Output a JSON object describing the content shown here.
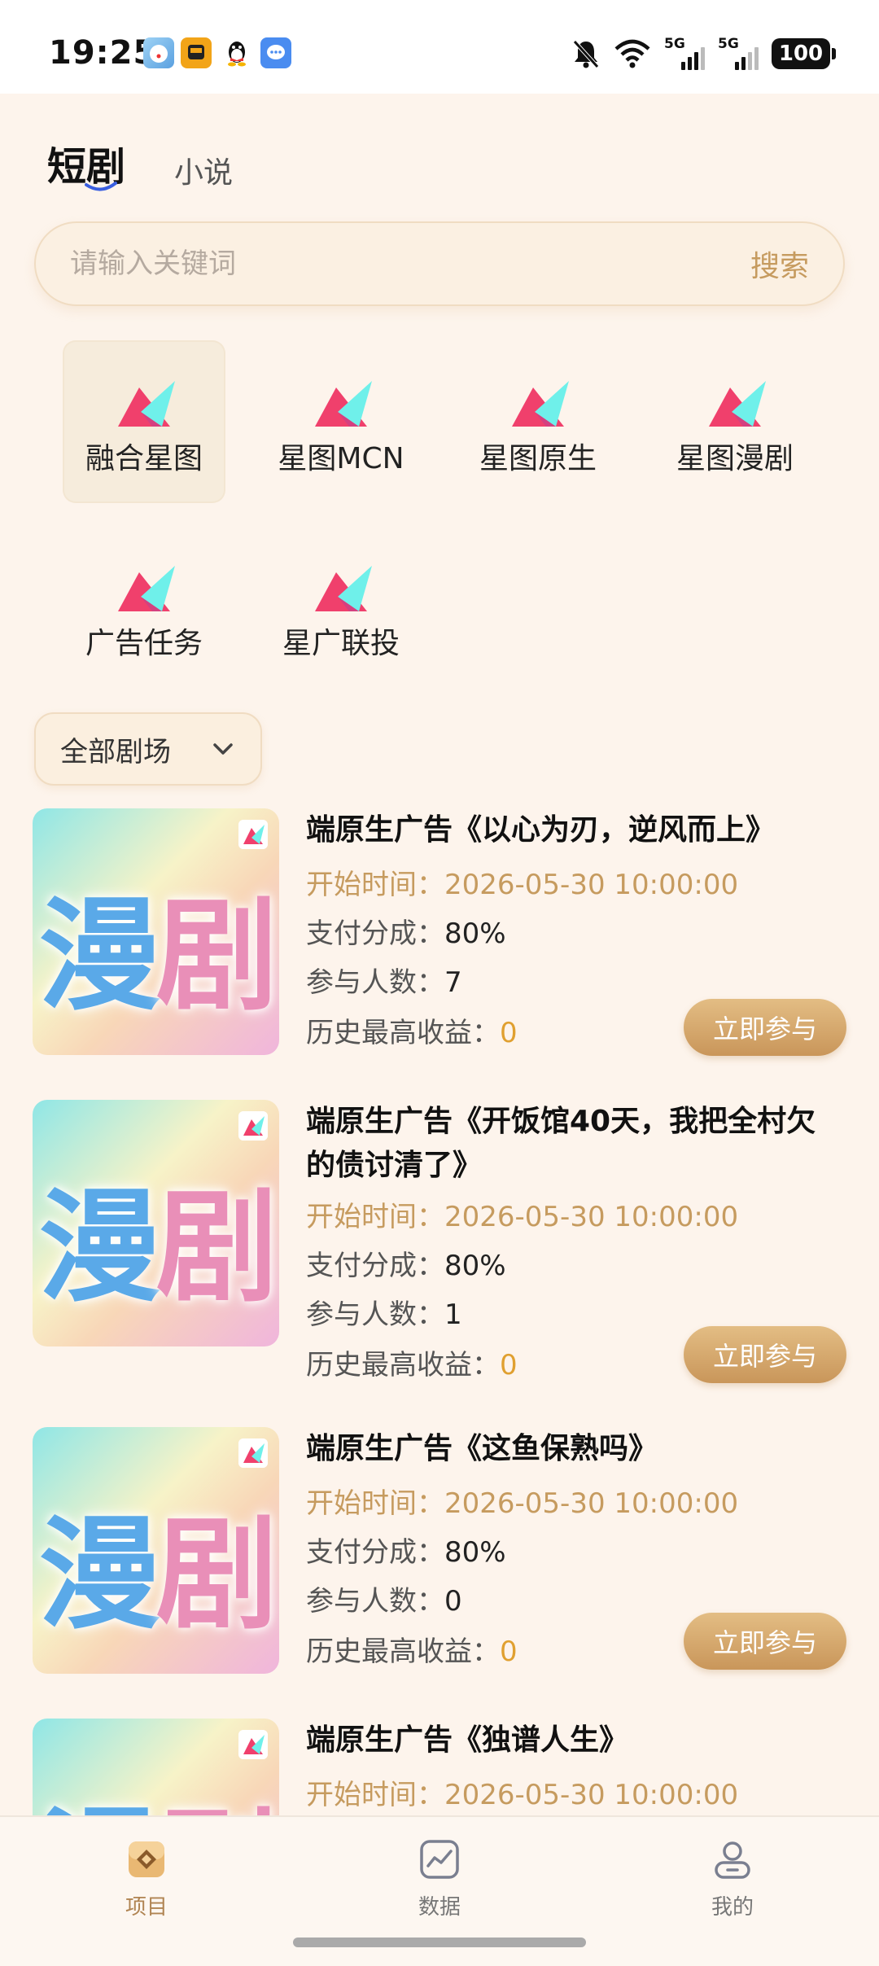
{
  "status_bar": {
    "time": "19:25",
    "battery": "100",
    "signal_labels": [
      "5G",
      "5G"
    ],
    "notification_app_icons": [
      "doraemon-app-icon",
      "train-ticket-app-icon",
      "qq-penguin-icon",
      "message-bubble-icon"
    ]
  },
  "top_tabs": [
    {
      "label": "短剧",
      "active": true
    },
    {
      "label": "小说",
      "active": false
    }
  ],
  "search": {
    "placeholder": "请输入关键词",
    "button_label": "搜索"
  },
  "categories": [
    {
      "label": "融合星图",
      "selected": true
    },
    {
      "label": "星图MCN",
      "selected": false
    },
    {
      "label": "星图原生",
      "selected": false
    },
    {
      "label": "星图漫剧",
      "selected": false
    },
    {
      "label": "广告任务",
      "selected": false
    },
    {
      "label": "星广联投",
      "selected": false
    }
  ],
  "filter": {
    "label": "全部剧场"
  },
  "field_labels": {
    "start_time": "开始时间：",
    "revenue_share": "支付分成：",
    "participants": "参与人数：",
    "max_earnings": "历史最高收益："
  },
  "items": [
    {
      "thumb_text": "漫剧",
      "title": "端原生广告《以心为刃，逆风而上》",
      "start_time": "2026-05-30 10:00:00",
      "revenue_share": "80%",
      "participants": "7",
      "max_earnings": "0",
      "join_label": "立即参与"
    },
    {
      "thumb_text": "漫剧",
      "title": "端原生广告《开饭馆40天，我把全村欠的债讨清了》",
      "start_time": "2026-05-30 10:00:00",
      "revenue_share": "80%",
      "participants": "1",
      "max_earnings": "0",
      "join_label": "立即参与"
    },
    {
      "thumb_text": "漫剧",
      "title": "端原生广告《这鱼保熟吗》",
      "start_time": "2026-05-30 10:00:00",
      "revenue_share": "80%",
      "participants": "0",
      "max_earnings": "0",
      "join_label": "立即参与"
    },
    {
      "thumb_text": "漫剧",
      "title": "端原生广告《独谱人生》",
      "start_time": "2026-05-30 10:00:00"
    }
  ],
  "bottom_nav": [
    {
      "label": "项目",
      "icon": "project-icon",
      "active": true
    },
    {
      "label": "数据",
      "icon": "chart-icon",
      "active": false
    },
    {
      "label": "我的",
      "icon": "profile-icon",
      "active": false
    }
  ],
  "colors": {
    "accent_gold": "#c69b5f",
    "button_gradient_start": "#e3bd84",
    "button_gradient_end": "#c9965a",
    "page_background": "#fdf4ec",
    "earnings_value": "#e0a030"
  }
}
